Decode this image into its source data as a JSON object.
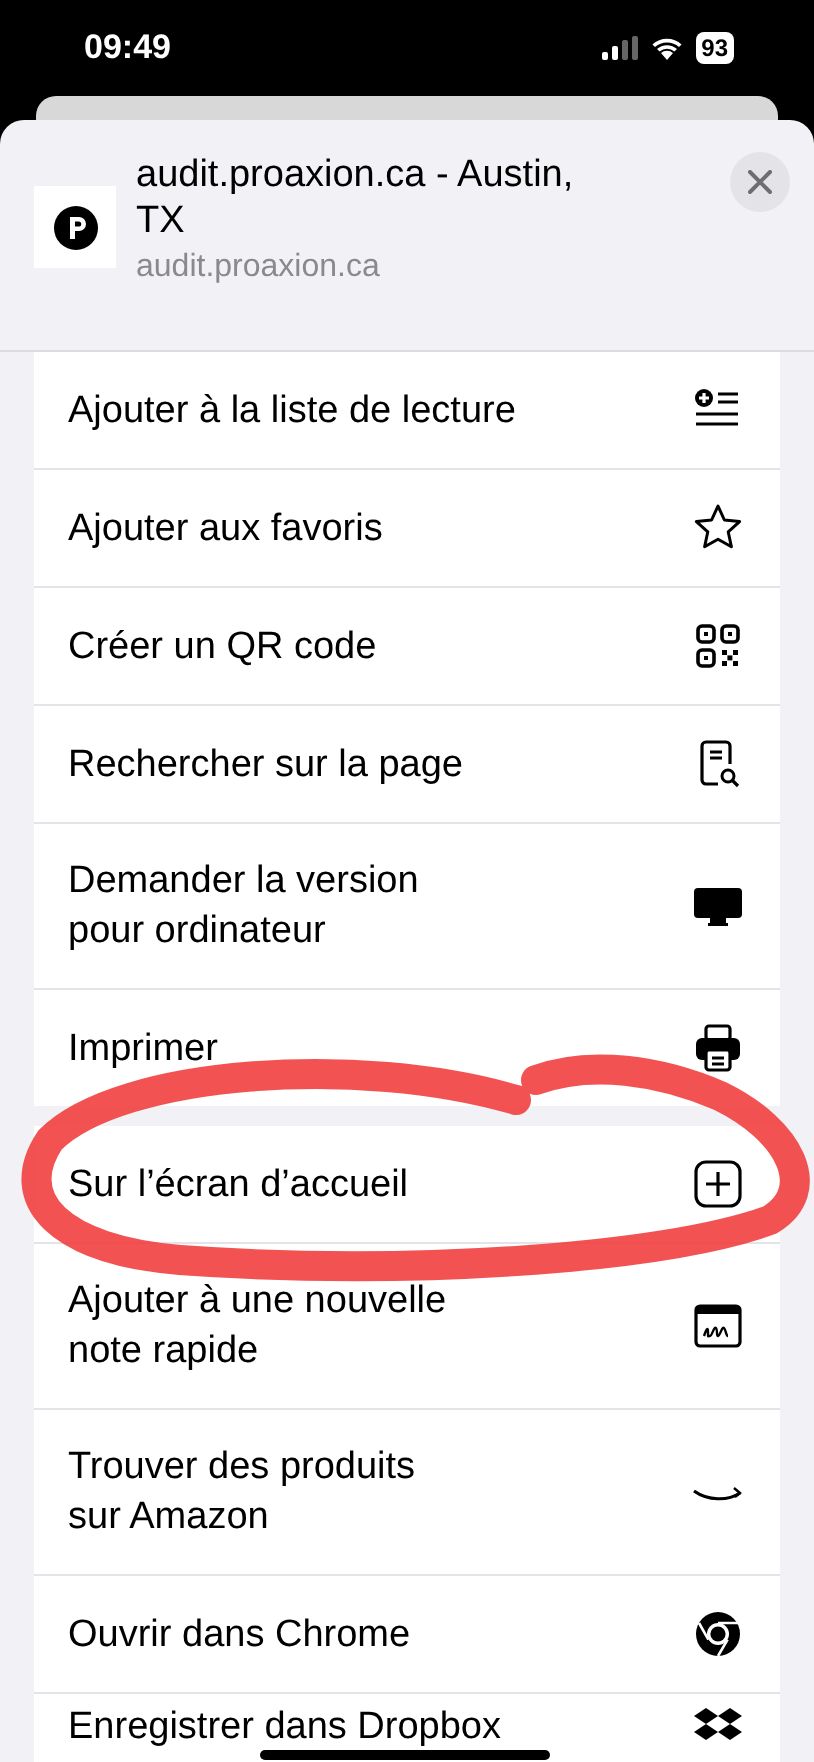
{
  "status_bar": {
    "time": "09:49",
    "battery": "93"
  },
  "header": {
    "title": "audit.proaxion.ca - Austin, TX",
    "subtitle": "audit.proaxion.ca"
  },
  "sections": [
    {
      "rows": [
        {
          "label": "Ajouter à la liste de lecture"
        },
        {
          "label": "Ajouter aux favoris"
        },
        {
          "label": "Créer un QR code"
        },
        {
          "label": "Rechercher sur la page"
        },
        {
          "label": "Demander la version\npour ordinateur"
        },
        {
          "label": "Imprimer"
        }
      ]
    },
    {
      "rows": [
        {
          "label": "Sur l’écran d’accueil"
        },
        {
          "label": "Ajouter à une nouvelle\nnote rapide"
        },
        {
          "label": "Trouver des produits\nsur Amazon"
        },
        {
          "label": "Ouvrir dans Chrome"
        },
        {
          "label": "Enregistrer dans Dropbox"
        }
      ]
    }
  ]
}
